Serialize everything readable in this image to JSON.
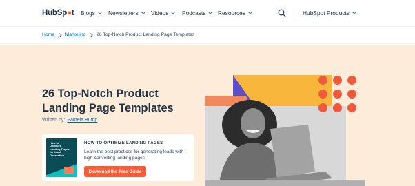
{
  "header": {
    "logo_text_a": "Hub",
    "logo_text_b": "Sp",
    "logo_text_c": "t",
    "nav": [
      {
        "label": "Blogs"
      },
      {
        "label": "Newsletters"
      },
      {
        "label": "Videos"
      },
      {
        "label": "Podcasts"
      },
      {
        "label": "Resources"
      }
    ],
    "search_icon": "search-icon",
    "products_label": "HubSpot Products"
  },
  "breadcrumb": {
    "home": "Home",
    "section": "Marketing",
    "current": "26 Top-Notch Product Landing Page Templates"
  },
  "article": {
    "title": "26 Top-Notch Product Landing Page Templates",
    "written_by_label": "Written by:",
    "author": "Pamela Bump"
  },
  "cta": {
    "book_text": "How to Optimize Landing Pages for Lead Generation",
    "heading": "HOW TO OPTIMIZE LANDING PAGES",
    "description": "Learn the best practices for generating leads with high-converting landing pages",
    "button_label": "Download the Free Guide"
  },
  "colors": {
    "brand_orange": "#ff5c35",
    "hero_bg": "#fdecd9",
    "link_blue": "#0068b1",
    "navy": "#213343"
  }
}
